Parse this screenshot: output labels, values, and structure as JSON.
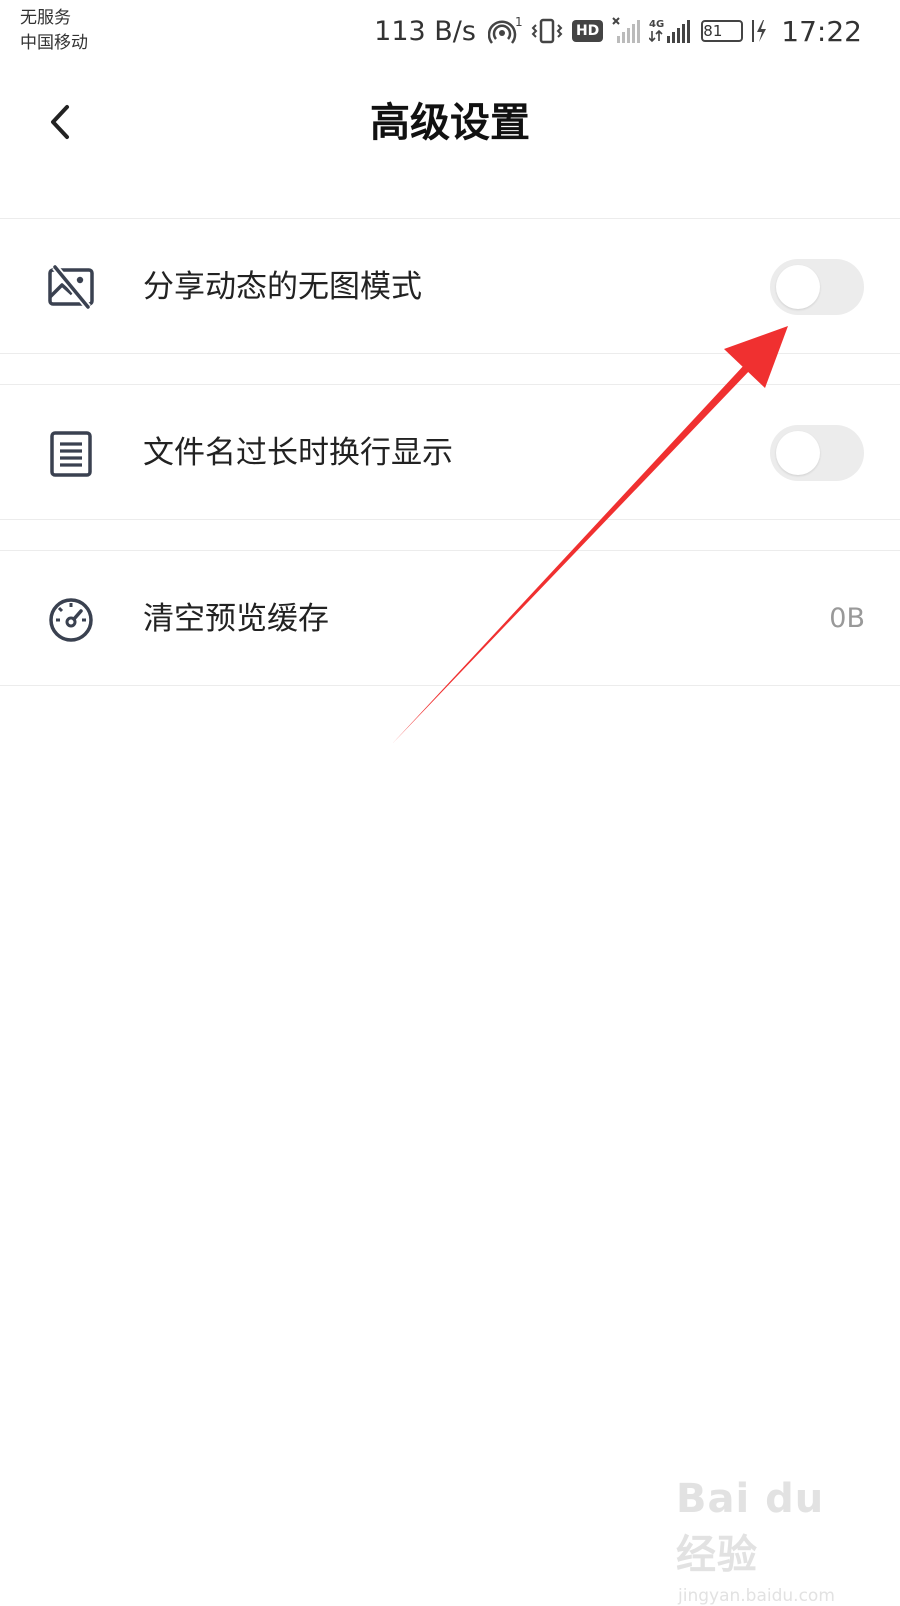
{
  "status_bar": {
    "carrier_line1": "无服务",
    "carrier_line2": "中国移动",
    "net_speed": "113 B/s",
    "hotspot_count": "1",
    "hd_label": "HD",
    "network_type": "4G",
    "battery_level": "81",
    "time": "17:22",
    "icons": [
      "hotspot-icon",
      "vibrate-icon",
      "hd-icon",
      "no-signal-icon",
      "signal-4g-icon",
      "battery-icon",
      "charging-icon"
    ]
  },
  "header": {
    "title": "高级设置",
    "back_icon": "chevron-left-icon"
  },
  "settings": [
    {
      "icon": "no-image-icon",
      "label": "分享动态的无图模式",
      "control": "toggle",
      "on": false
    },
    {
      "icon": "document-icon",
      "label": "文件名过长时换行显示",
      "control": "toggle",
      "on": false
    },
    {
      "icon": "speedometer-icon",
      "label": "清空预览缓存",
      "control": "value",
      "value": "0B"
    }
  ],
  "watermark": {
    "logo": "Bai du 经验",
    "url": "jingyan.baidu.com"
  },
  "colors": {
    "annotation_arrow": "#f03030",
    "toggle_off": "#ececec",
    "value_text": "#999999",
    "icon_stroke": "#3a4150"
  }
}
